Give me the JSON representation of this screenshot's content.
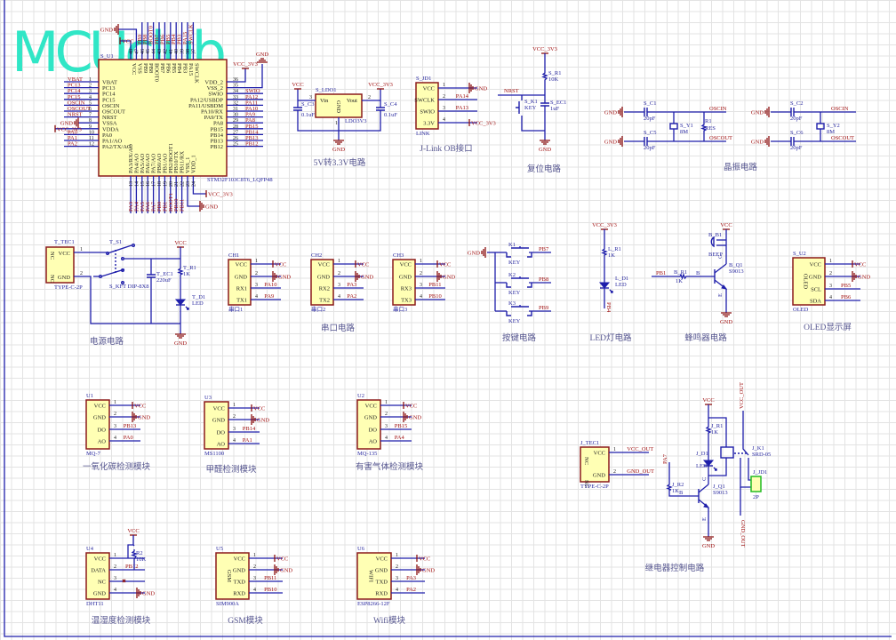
{
  "logo": "MCUclub",
  "nets": {
    "vcc": "VCC",
    "gnd": "GND",
    "vcc3v3": "VCC_3V3"
  },
  "mcu": {
    "ref": "S_U1",
    "part": "STM32F103C8T6_LQFP48",
    "left_pins": [
      {
        "num": "1",
        "name": "VBAT",
        "net": "VBAT"
      },
      {
        "num": "2",
        "name": "PC13",
        "net": "PC13"
      },
      {
        "num": "3",
        "name": "PC14",
        "net": "PC14"
      },
      {
        "num": "4",
        "name": "PC15",
        "net": "PC15"
      },
      {
        "num": "5",
        "name": "OSCIN",
        "net": "OSCIN"
      },
      {
        "num": "6",
        "name": "OSCOUT",
        "net": "OSCOUT"
      },
      {
        "num": "7",
        "name": "NRST",
        "net": "NRST"
      },
      {
        "num": "8",
        "name": "VSSA",
        "net": "GND"
      },
      {
        "num": "9",
        "name": "VDDA",
        "net": "VCC_3V3"
      },
      {
        "num": "10",
        "name": "PA0",
        "net": "PA0"
      },
      {
        "num": "11",
        "name": "PA1/AO",
        "net": "PA1"
      },
      {
        "num": "12",
        "name": "PA2/TX/AO",
        "net": "PA2"
      }
    ],
    "right_pins": [
      {
        "num": "36",
        "name": "VDD_2",
        "net": ""
      },
      {
        "num": "35",
        "name": "VSS_2",
        "net": ""
      },
      {
        "num": "34",
        "name": "SWIO",
        "net": "SWIO"
      },
      {
        "num": "33",
        "name": "PA12/USBDP",
        "net": "PA12"
      },
      {
        "num": "32",
        "name": "PA11/USBDM",
        "net": "PA11"
      },
      {
        "num": "31",
        "name": "PA10/RX",
        "net": "PA10"
      },
      {
        "num": "30",
        "name": "PA9/TX",
        "net": "PA9"
      },
      {
        "num": "29",
        "name": "PA8",
        "net": "PA8"
      },
      {
        "num": "28",
        "name": "PB15",
        "net": "PB15"
      },
      {
        "num": "27",
        "name": "PB14",
        "net": "PB14"
      },
      {
        "num": "26",
        "name": "PB13",
        "net": "PB13"
      },
      {
        "num": "25",
        "name": "PB12",
        "net": "PB12"
      }
    ],
    "top_pins": [
      {
        "num": "48",
        "name": "VCC",
        "net": ""
      },
      {
        "num": "47",
        "name": "VSS",
        "net": ""
      },
      {
        "num": "46",
        "name": "PB9",
        "net": "PB9"
      },
      {
        "num": "45",
        "name": "PB8",
        "net": "PB8"
      },
      {
        "num": "44",
        "name": "BOOT0",
        "net": "BOOT0"
      },
      {
        "num": "43",
        "name": "PB7",
        "net": "PB7"
      },
      {
        "num": "42",
        "name": "PB6",
        "net": "PB6"
      },
      {
        "num": "41",
        "name": "PB5",
        "net": "PB5"
      },
      {
        "num": "40",
        "name": "PB4",
        "net": "PB4"
      },
      {
        "num": "39",
        "name": "PB3",
        "net": "PB3"
      },
      {
        "num": "38",
        "name": "PA15",
        "net": "PA15"
      },
      {
        "num": "37",
        "name": "SWCLK",
        "net": "SWCLK"
      }
    ],
    "bottom_pins": [
      {
        "num": "13",
        "name": "PA3/RX/AO",
        "net": "PA3"
      },
      {
        "num": "14",
        "name": "PA4/AO",
        "net": "PA4"
      },
      {
        "num": "15",
        "name": "PA5/AO",
        "net": "PA5"
      },
      {
        "num": "16",
        "name": "PA6/AO",
        "net": "PA6"
      },
      {
        "num": "17",
        "name": "PA7/AO",
        "net": "PA7"
      },
      {
        "num": "18",
        "name": "PB0/AO",
        "net": "PB0"
      },
      {
        "num": "19",
        "name": "PB1/AO",
        "net": "PB1"
      },
      {
        "num": "20",
        "name": "PB2/BOOT1",
        "net": "BOOT1"
      },
      {
        "num": "21",
        "name": "PB10/TX",
        "net": "PB10"
      },
      {
        "num": "22",
        "name": "PB11/RX",
        "net": "PB11"
      },
      {
        "num": "23",
        "name": "VSS_1",
        "net": ""
      },
      {
        "num": "24",
        "name": "VDD_1",
        "net": ""
      }
    ]
  },
  "ldo": {
    "ref": "S_LDO1",
    "part": "LDO3V3",
    "vin": "Vin",
    "vout": "Vout",
    "gnd": "GND",
    "pin_vin": "3",
    "pin_vout": "2",
    "pin_gnd": "1",
    "c3_ref": "S_C3",
    "c3_val": "0.1uF",
    "c4_ref": "S_C4",
    "c4_val": "0.1uF"
  },
  "reset": {
    "r_ref": "S_R1",
    "r_val": "10K",
    "net": "NRST",
    "k_ref": "S_K1",
    "k_val": "KEY",
    "c_ref": "S_EC1",
    "c_val": "1uF"
  },
  "crystal": {
    "c1_ref": "S_C1",
    "c1_val": "20pF",
    "c5_ref": "S_C5",
    "c5_val": "20pF",
    "y1_ref": "S_Y1",
    "y1_val": "8M",
    "r_ref": "R1",
    "r_val": "RES",
    "c2_ref": "S_C2",
    "c2_val": "20pF",
    "c6_ref": "S_C6",
    "c6_val": "20pF",
    "y2_ref": "S_Y2",
    "y2_val": "8M",
    "oscin": "OSCIN",
    "oscout": "OSCOUT"
  },
  "power": {
    "tec_ref": "T_TEC1",
    "tec_part": "TYPE-C-2P",
    "tec_vcc": "VCC",
    "tec_gnd": "GND",
    "nc": "NC",
    "pin1": "1",
    "pin2": "2",
    "sw_ref": "T_S1",
    "sw_part": "S_KFT DIP-8X8",
    "ec_ref": "T_EC1",
    "ec_val": "220uF",
    "r_ref": "T_R1",
    "r_val": "1K",
    "d_ref": "T_D1",
    "d_val": "LED"
  },
  "keys": [
    {
      "ref": "K1",
      "val": "KEY",
      "net": "PB7"
    },
    {
      "ref": "K2",
      "val": "KEY",
      "net": "PB8"
    },
    {
      "ref": "K3",
      "val": "KEY",
      "net": "PB9"
    }
  ],
  "led": {
    "r_ref": "L_R1",
    "r_val": "1K",
    "d_ref": "L_D1",
    "d_val": "LED",
    "net": "PB4"
  },
  "buzzer": {
    "b_ref": "B_B1",
    "b_val": "BEEP",
    "q_ref": "B_Q1",
    "q_val": "S9013",
    "net": "PB1",
    "r_ref": "B_R1",
    "r_val": "1K",
    "b": "B",
    "c": "C",
    "e": "E"
  },
  "relay": {
    "vcc_out": "VCC_OUT",
    "gnd_out": "GND_OUT",
    "r1_ref": "J_R1",
    "r1_val": "1K",
    "d_ref": "J_D1",
    "d_val": "LED",
    "k_ref": "J_K1",
    "k_val": "SRD-05",
    "jd_ref": "J_JD1",
    "jd_val": "2P",
    "r2_ref": "J_R2",
    "r2_val": "1K",
    "net": "PA7",
    "q_ref": "J_Q1",
    "q_val": "S9013",
    "b": "B",
    "c": "C",
    "e": "E"
  },
  "dht_res": {
    "ref": "R2",
    "val": "10K"
  },
  "modules": {
    "jlink": {
      "ref": "S_JD1",
      "part": "LINK",
      "pins": [
        {
          "num": "1",
          "name": "VCC",
          "net": "GND"
        },
        {
          "num": "2",
          "name": "SWCLK",
          "net": "PA14"
        },
        {
          "num": "3",
          "name": "SWIO",
          "net": "PA13"
        },
        {
          "num": "4",
          "name": "3.3V",
          "net": "VCC_3V3"
        }
      ]
    },
    "ch1": {
      "ref": "CH1",
      "part": "串口1",
      "pins": [
        {
          "num": "1",
          "name": "VCC",
          "net": "VCC"
        },
        {
          "num": "2",
          "name": "GND",
          "net": "GND"
        },
        {
          "num": "3",
          "name": "RX1",
          "net": "PA10"
        },
        {
          "num": "4",
          "name": "TX1",
          "net": "PA9"
        }
      ]
    },
    "ch2": {
      "ref": "CH2",
      "part": "串口2",
      "pins": [
        {
          "num": "1",
          "name": "VCC",
          "net": "VCC"
        },
        {
          "num": "2",
          "name": "GND",
          "net": "GND"
        },
        {
          "num": "3",
          "name": "RX2",
          "net": "PA3"
        },
        {
          "num": "4",
          "name": "TX2",
          "net": "PA2"
        }
      ]
    },
    "ch3": {
      "ref": "CH3",
      "part": "串口3",
      "pins": [
        {
          "num": "1",
          "name": "VCC",
          "net": "VCC"
        },
        {
          "num": "2",
          "name": "GND",
          "net": "GND"
        },
        {
          "num": "3",
          "name": "RX3",
          "net": "PB11"
        },
        {
          "num": "4",
          "name": "TX3",
          "net": "PB10"
        }
      ]
    },
    "oled": {
      "ref": "S_U2",
      "part": "OLED",
      "inner": "OLED",
      "pins": [
        {
          "num": "1",
          "name": "VCC",
          "net": "VCC"
        },
        {
          "num": "2",
          "name": "GND",
          "net": "GND"
        },
        {
          "num": "3",
          "name": "SCL",
          "net": "PB5"
        },
        {
          "num": "4",
          "name": "SDA",
          "net": "PB6"
        }
      ]
    },
    "u1": {
      "ref": "U1",
      "part": "MQ-7",
      "pins": [
        {
          "num": "1",
          "name": "VCC",
          "net": "VCC"
        },
        {
          "num": "2",
          "name": "GND",
          "net": "GND"
        },
        {
          "num": "3",
          "name": "DO",
          "net": "PB13"
        },
        {
          "num": "4",
          "name": "AO",
          "net": "PA0"
        }
      ]
    },
    "u3": {
      "ref": "U3",
      "part": "MS1100",
      "pins": [
        {
          "num": "1",
          "name": "VCC",
          "net": "VCC"
        },
        {
          "num": "2",
          "name": "GND",
          "net": "GND"
        },
        {
          "num": "3",
          "name": "DO",
          "net": "PB14"
        },
        {
          "num": "4",
          "name": "AO",
          "net": "PA1"
        }
      ]
    },
    "u2": {
      "ref": "U2",
      "part": "MQ-135",
      "pins": [
        {
          "num": "1",
          "name": "VCC",
          "net": "VCC"
        },
        {
          "num": "2",
          "name": "GND",
          "net": "GND"
        },
        {
          "num": "3",
          "name": "DO",
          "net": "PB15"
        },
        {
          "num": "4",
          "name": "AO",
          "net": "PA4"
        }
      ]
    },
    "u4": {
      "ref": "U4",
      "part": "DHT11",
      "pins": [
        {
          "num": "1",
          "name": "VCC",
          "net": ""
        },
        {
          "num": "2",
          "name": "DATA",
          "net": "PB12"
        },
        {
          "num": "3",
          "name": "NC",
          "net": ""
        },
        {
          "num": "4",
          "name": "GND",
          "net": "GND"
        }
      ]
    },
    "u5": {
      "ref": "U5",
      "part": "SIM900A",
      "inner": "GSM",
      "pins": [
        {
          "num": "1",
          "name": "VCC",
          "net": "VCC"
        },
        {
          "num": "2",
          "name": "GND",
          "net": "GND"
        },
        {
          "num": "3",
          "name": "TXD",
          "net": "PB11"
        },
        {
          "num": "4",
          "name": "RXD",
          "net": "PB10"
        }
      ]
    },
    "u6": {
      "ref": "U6",
      "part": "ESP8266-12F",
      "inner": "WIFI",
      "pins": [
        {
          "num": "1",
          "name": "VCC",
          "net": "VCC"
        },
        {
          "num": "2",
          "name": "GND",
          "net": "GND"
        },
        {
          "num": "3",
          "name": "TXD",
          "net": "PA3"
        },
        {
          "num": "4",
          "name": "RXD",
          "net": "PA2"
        }
      ]
    },
    "jtec": {
      "ref": "J_TEC1",
      "part": "TYPE-C-2P",
      "pins": [
        {
          "num": "1",
          "name": "VCC",
          "net": "VCC_OUT"
        },
        {
          "num": "2",
          "name": "GND",
          "net": "GND_OUT"
        }
      ]
    }
  },
  "titles": {
    "ldo": "5V转3.3V电路",
    "jlink": "J-Link OB接口",
    "reset": "复位电路",
    "crystal": "晶振电路",
    "power": "电源电路",
    "serial": "串口电路",
    "keys": "按键电路",
    "led": "LED灯电路",
    "buzzer": "蜂鸣器电路",
    "oled": "OLED显示屏",
    "co": "一氧化碳检测模块",
    "hcho": "甲醛检测模块",
    "gas": "有害气体检测模块",
    "relay": "继电器控制电路",
    "dht": "温湿度检测模块",
    "gsm": "GSM模块",
    "wifi": "Wifi模块"
  },
  "colors": {
    "wire": "#1e1eaa",
    "power": "#8b1010",
    "chip_fill": "#ffffb4",
    "chip_border": "#8b1a1a",
    "logo": "#30e6c6",
    "connector": "#22bb22"
  }
}
